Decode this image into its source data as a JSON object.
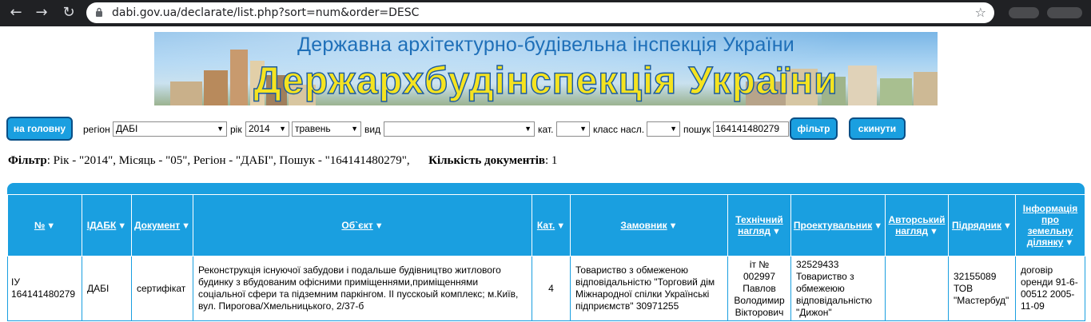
{
  "browser": {
    "url": "dabi.gov.ua/declarate/list.php?sort=num&order=DESC"
  },
  "banner": {
    "subtitle": "Державна архітектурно-будівельна інспекція України",
    "title": "Держархбудінспекція України"
  },
  "filters": {
    "home_button": "на головну",
    "region_label": "регіон",
    "region_value": "ДАБІ",
    "year_label": "рік",
    "year_value": "2014",
    "month_value": "травень",
    "type_label": "вид",
    "type_value": "",
    "cat_label": "кат.",
    "cat_value": "",
    "class_label": "класс насл.",
    "class_value": "",
    "search_label": "пошук",
    "search_value": "164141480279",
    "filter_button": "фільтр",
    "reset_button": "скинути"
  },
  "summary": {
    "filter_label": "Фільтр",
    "filter_text": ": Рік - \"2014\", Місяць - \"05\", Регіон - \"ДАБІ\", Пошук - \"164141480279\",",
    "count_label": "Кількість документів",
    "count_value": ": 1"
  },
  "table": {
    "columns": [
      "№",
      "ІДАБК",
      "Документ",
      "Об`єкт",
      "Кат.",
      "Замовник",
      "Технічний нагляд",
      "Проектувальник",
      "Авторський нагляд",
      "Підрядник",
      "Інформація про земельну ділянку"
    ],
    "rows": [
      [
        "ІУ 164141480279",
        "ДАБІ",
        "сертифікат",
        "Реконструкція існуючої забудови і подальше будівництво житлового будинку з вбудованим офісними приміщеннями,приміщеннями соціальної сфери та підземним паркінгом. ІІ пусскоый комплекс; м.Київ, вул. Пирогова/Хмельницького, 2/37-б",
        "4",
        "Товариство з обмеженою відповідальністю \"Торговий дім Міжнародної спілки Українські підприємств\" 30971255",
        "іт № 002997 Павлов Володимир Вікторович",
        "32529433 Товариство з обмежеюю відповідальністю \"Дижон\"",
        "",
        "32155089 ТОВ \"Мастербуд\"",
        "договір оренди 91-6-00512 2005-11-09"
      ]
    ]
  },
  "icons": {
    "sort": "▼",
    "dropdown": "▼"
  }
}
